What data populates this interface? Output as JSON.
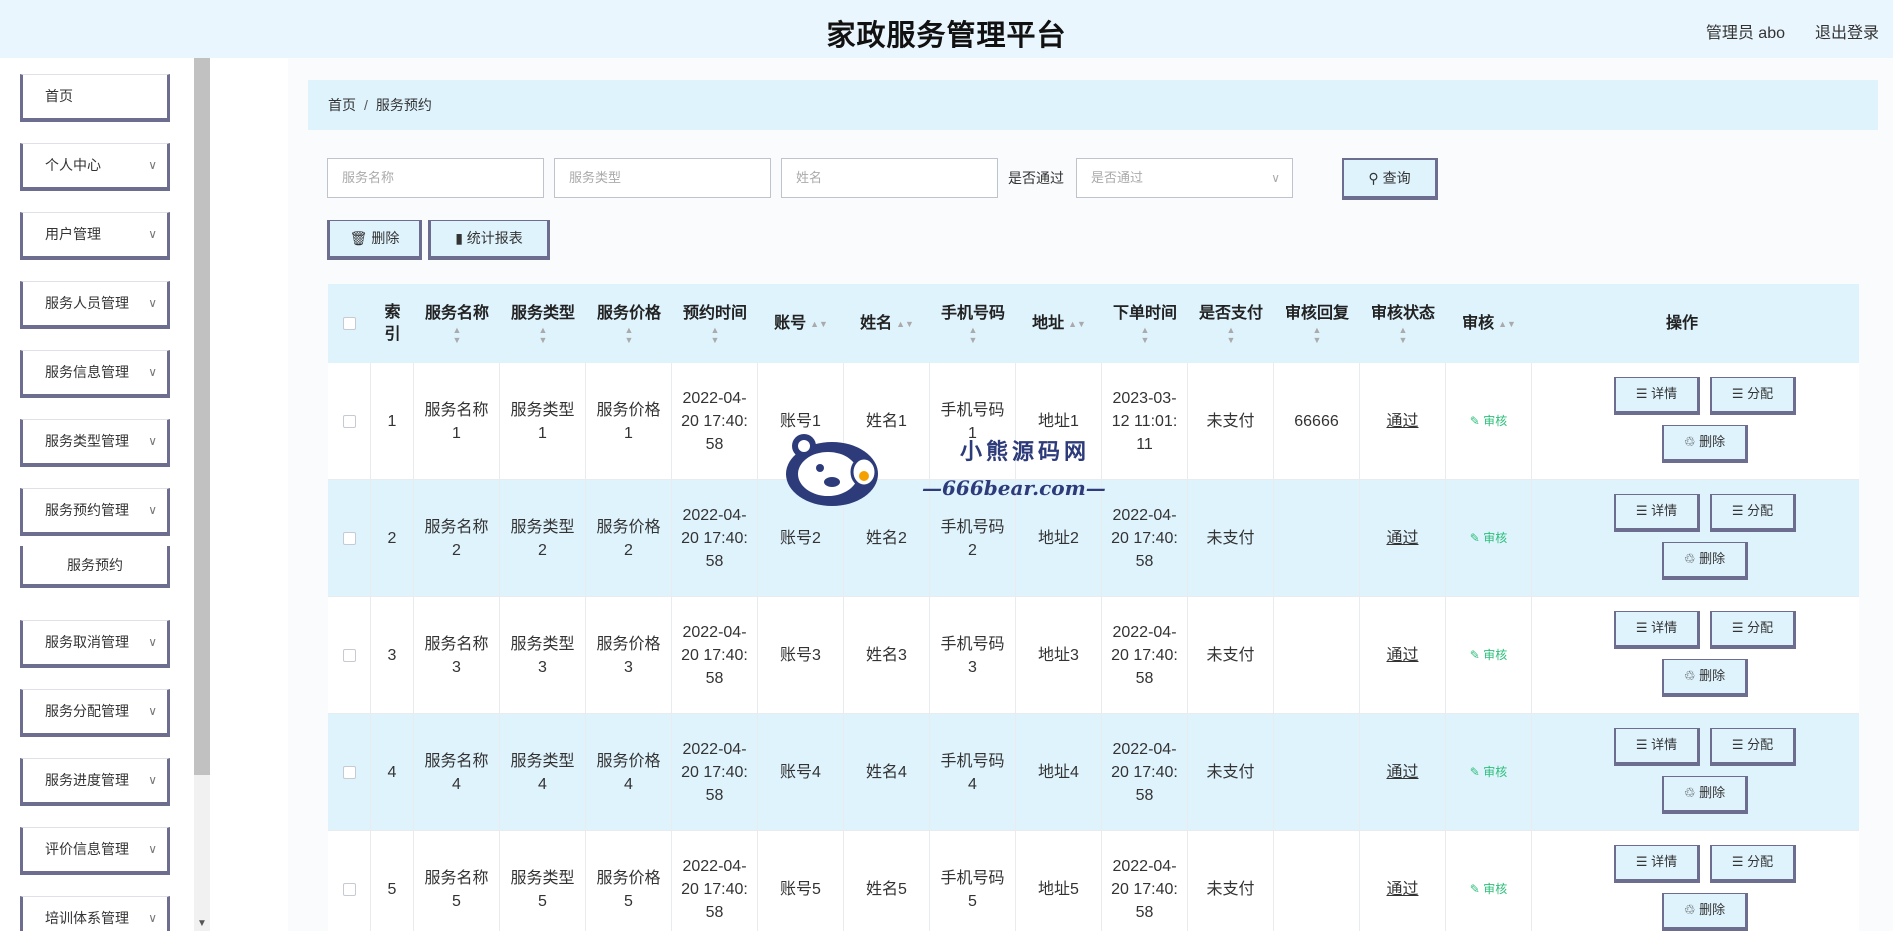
{
  "header": {
    "title": "家政服务管理平台",
    "user": "管理员 abo",
    "logout": "退出登录"
  },
  "sidebar": {
    "items": [
      {
        "label": "首页",
        "has_children": false
      },
      {
        "label": "个人中心",
        "has_children": true
      },
      {
        "label": "用户管理",
        "has_children": true
      },
      {
        "label": "服务人员管理",
        "has_children": true
      },
      {
        "label": "服务信息管理",
        "has_children": true
      },
      {
        "label": "服务类型管理",
        "has_children": true
      },
      {
        "label": "服务预约管理",
        "has_children": true
      },
      {
        "label": "服务取消管理",
        "has_children": true
      },
      {
        "label": "服务分配管理",
        "has_children": true
      },
      {
        "label": "服务进度管理",
        "has_children": true
      },
      {
        "label": "评价信息管理",
        "has_children": true
      },
      {
        "label": "培训体系管理",
        "has_children": true
      }
    ],
    "subitem": "服务预约"
  },
  "breadcrumb": {
    "home": "首页",
    "separator": "/",
    "current": "服务预约"
  },
  "search": {
    "service_name_placeholder": "服务名称",
    "service_type_placeholder": "服务类型",
    "name_placeholder": "姓名",
    "passed_label": "是否通过",
    "passed_placeholder": "是否通过",
    "query_label": "查询"
  },
  "actions": {
    "delete_label": "删除",
    "report_label": "统计报表"
  },
  "table": {
    "headers": [
      "索引",
      "服务名称",
      "服务类型",
      "服务价格",
      "预约时间",
      "账号",
      "姓名",
      "手机号码",
      "地址",
      "下单时间",
      "是否支付",
      "审核回复",
      "审核状态",
      "审核",
      "操作"
    ],
    "rows": [
      {
        "index": "1",
        "service_name": "服务名称1",
        "service_type": "服务类型1",
        "price": "服务价格1",
        "booking_time": "2022-04-20 17:40:58",
        "account": "账号1",
        "name": "姓名1",
        "phone": "手机号码1",
        "address": "地址1",
        "order_time": "2023-03-12 11:01:11",
        "paid": "未支付",
        "reply": "66666",
        "status": "通过",
        "audit": "审核"
      },
      {
        "index": "2",
        "service_name": "服务名称2",
        "service_type": "服务类型2",
        "price": "服务价格2",
        "booking_time": "2022-04-20 17:40:58",
        "account": "账号2",
        "name": "姓名2",
        "phone": "手机号码2",
        "address": "地址2",
        "order_time": "2022-04-20 17:40:58",
        "paid": "未支付",
        "reply": "",
        "status": "通过",
        "audit": "审核"
      },
      {
        "index": "3",
        "service_name": "服务名称3",
        "service_type": "服务类型3",
        "price": "服务价格3",
        "booking_time": "2022-04-20 17:40:58",
        "account": "账号3",
        "name": "姓名3",
        "phone": "手机号码3",
        "address": "地址3",
        "order_time": "2022-04-20 17:40:58",
        "paid": "未支付",
        "reply": "",
        "status": "通过",
        "audit": "审核"
      },
      {
        "index": "4",
        "service_name": "服务名称4",
        "service_type": "服务类型4",
        "price": "服务价格4",
        "booking_time": "2022-04-20 17:40:58",
        "account": "账号4",
        "name": "姓名4",
        "phone": "手机号码4",
        "address": "地址4",
        "order_time": "2022-04-20 17:40:58",
        "paid": "未支付",
        "reply": "",
        "status": "通过",
        "audit": "审核"
      },
      {
        "index": "5",
        "service_name": "服务名称5",
        "service_type": "服务类型5",
        "price": "服务价格5",
        "booking_time": "2022-04-20 17:40:58",
        "account": "账号5",
        "name": "姓名5",
        "phone": "手机号码5",
        "address": "地址5",
        "order_time": "2022-04-20 17:40:58",
        "paid": "未支付",
        "reply": "",
        "status": "通过",
        "audit": "审核"
      }
    ],
    "row_buttons": {
      "detail": "详情",
      "assign": "分配",
      "delete": "删除"
    }
  },
  "watermark": {
    "cn": "小熊源码网",
    "en": "—666bear.com—"
  },
  "colors": {
    "header_bg": "#eaf6fd",
    "accent_bg": "#dff3fd",
    "button_border": "#6d6d8f",
    "audit_green": "#2ebf7a"
  }
}
